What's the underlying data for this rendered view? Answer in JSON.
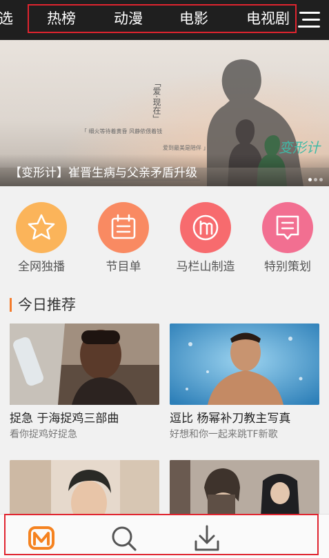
{
  "topnav": {
    "tabs": [
      {
        "label": "选"
      },
      {
        "label": "热榜"
      },
      {
        "label": "动漫"
      },
      {
        "label": "电影"
      },
      {
        "label": "电视剧"
      }
    ],
    "menu_icon": "hamburger-menu-icon"
  },
  "banner": {
    "caption": "【变形计】崔晋生病与父亲矛盾升级",
    "vertical_text": "「爱·现在」",
    "poem_line1": "「 细火等待着黄昏   风静依偎着钱",
    "poem_line2": "爱到最美是陪伴 」",
    "logo_text": "变形计",
    "page_count": 3,
    "active_page": 1
  },
  "quick_links": [
    {
      "label": "全网独播",
      "icon": "star-icon",
      "color": "#fbb45a"
    },
    {
      "label": "节目单",
      "icon": "calendar-list-icon",
      "color": "#f98a62"
    },
    {
      "label": "马栏山制造",
      "icon": "mango-m-icon",
      "color": "#f76b6e"
    },
    {
      "label": "特别策划",
      "icon": "message-board-icon",
      "color": "#f26f91"
    }
  ],
  "section": {
    "title": "今日推荐"
  },
  "cards": [
    {
      "title": "捉急 于海捉鸡三部曲",
      "subtitle": "看你捉鸡好捉急"
    },
    {
      "title": "逗比 杨幂补刀教主写真",
      "subtitle": "好想和你一起来跳TF新歌"
    },
    {
      "title": "",
      "subtitle": ""
    },
    {
      "title": "",
      "subtitle": ""
    }
  ],
  "bottom_nav": [
    {
      "icon": "mango-tv-logo-icon",
      "color": "#f5821f"
    },
    {
      "icon": "search-icon",
      "color": "#555555"
    },
    {
      "icon": "download-icon",
      "color": "#555555"
    }
  ]
}
